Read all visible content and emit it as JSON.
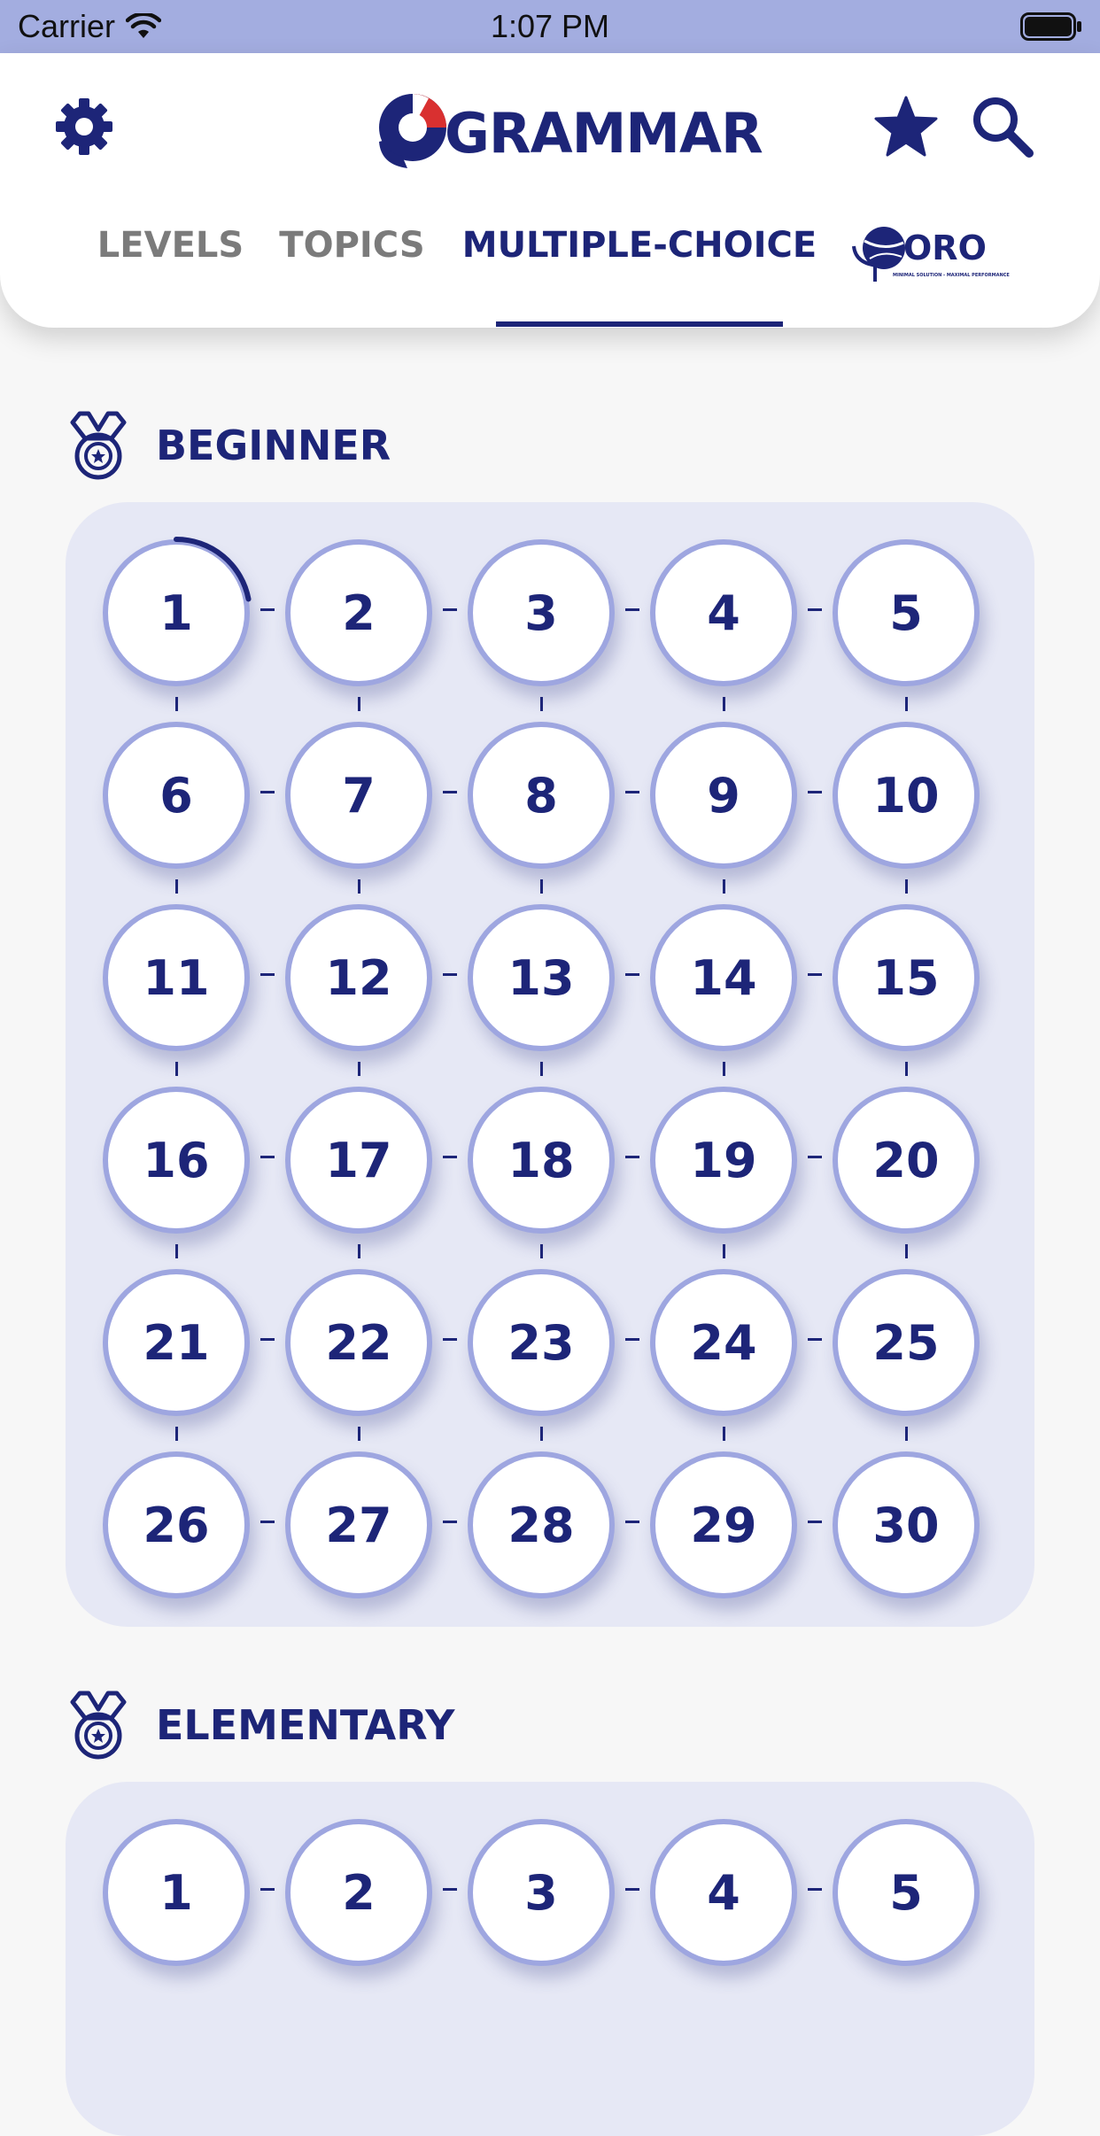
{
  "status_bar": {
    "carrier": "Carrier",
    "time": "1:07 PM"
  },
  "header": {
    "logo_text": "GRAMMAR",
    "tabs": [
      {
        "label": "LEVELS",
        "active": false
      },
      {
        "label": "TOPICS",
        "active": false
      },
      {
        "label": "MULTIPLE-CHOICE",
        "active": true
      }
    ],
    "oro_logo": {
      "text": "ORO",
      "tagline": "MINIMAL SOLUTION - MAXIMAL PERFORMANCE"
    },
    "icons": [
      "gear-icon",
      "star-icon",
      "search-icon"
    ]
  },
  "sections": [
    {
      "title": "BEGINNER",
      "levels": [
        "1",
        "2",
        "3",
        "4",
        "5",
        "6",
        "7",
        "8",
        "9",
        "10",
        "11",
        "12",
        "13",
        "14",
        "15",
        "16",
        "17",
        "18",
        "19",
        "20",
        "21",
        "22",
        "23",
        "24",
        "25",
        "26",
        "27",
        "28",
        "29",
        "30"
      ],
      "progress_level_1": 0.22
    },
    {
      "title": "ELEMENTARY",
      "levels": [
        "1",
        "2",
        "3",
        "4",
        "5"
      ]
    }
  ],
  "colors": {
    "accent": "#1d2578",
    "ring": "#9ea6e0",
    "status_bar": "#a3ade0",
    "panel": "#e6e8f5"
  }
}
